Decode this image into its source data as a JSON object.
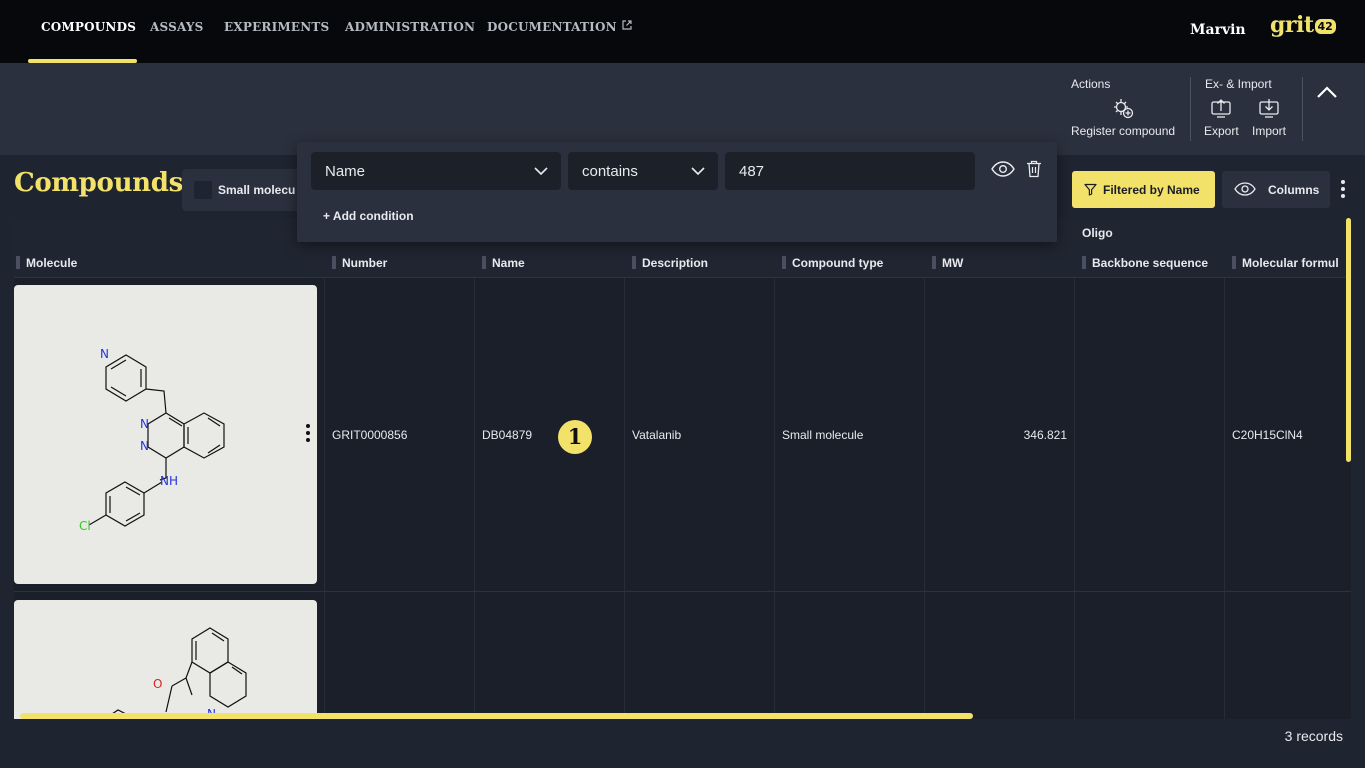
{
  "nav": {
    "items": [
      {
        "label": "COMPOUNDS",
        "active": true
      },
      {
        "label": "ASSAYS"
      },
      {
        "label": "EXPERIMENTS"
      },
      {
        "label": "ADMINISTRATION"
      },
      {
        "label": "DOCUMENTATION"
      }
    ],
    "user": "Marvin",
    "logo_text": "grit",
    "logo_badge": "42"
  },
  "actions": {
    "group1_title": "Actions",
    "register_label": "Register compound",
    "group2_title": "Ex- & Import",
    "export_label": "Export",
    "import_label": "Import"
  },
  "page": {
    "title": "Compounds",
    "type_toggle_label": "Small molecu",
    "filtered_label": "Filtered by Name",
    "columns_label": "Columns"
  },
  "filter": {
    "field": "Name",
    "operator": "contains",
    "value": "487",
    "add_condition": "+ Add condition"
  },
  "grid": {
    "group_header": "Oligo",
    "columns": [
      "Molecule",
      "Number",
      "Name",
      "Description",
      "Compound type",
      "MW",
      "Backbone sequence",
      "Molecular formul"
    ],
    "rows": [
      {
        "number": "GRIT0000856",
        "name": "DB04879",
        "description": "Vatalanib",
        "type": "Small molecule",
        "mw": "346.821",
        "backbone": "",
        "formula": "C20H15ClN4"
      }
    ],
    "badge": "1",
    "records": "3 records"
  },
  "colors": {
    "accent": "#f3e26a",
    "nav_bg": "#06080c",
    "panel": "#2a303d",
    "body": "#1e2430"
  }
}
